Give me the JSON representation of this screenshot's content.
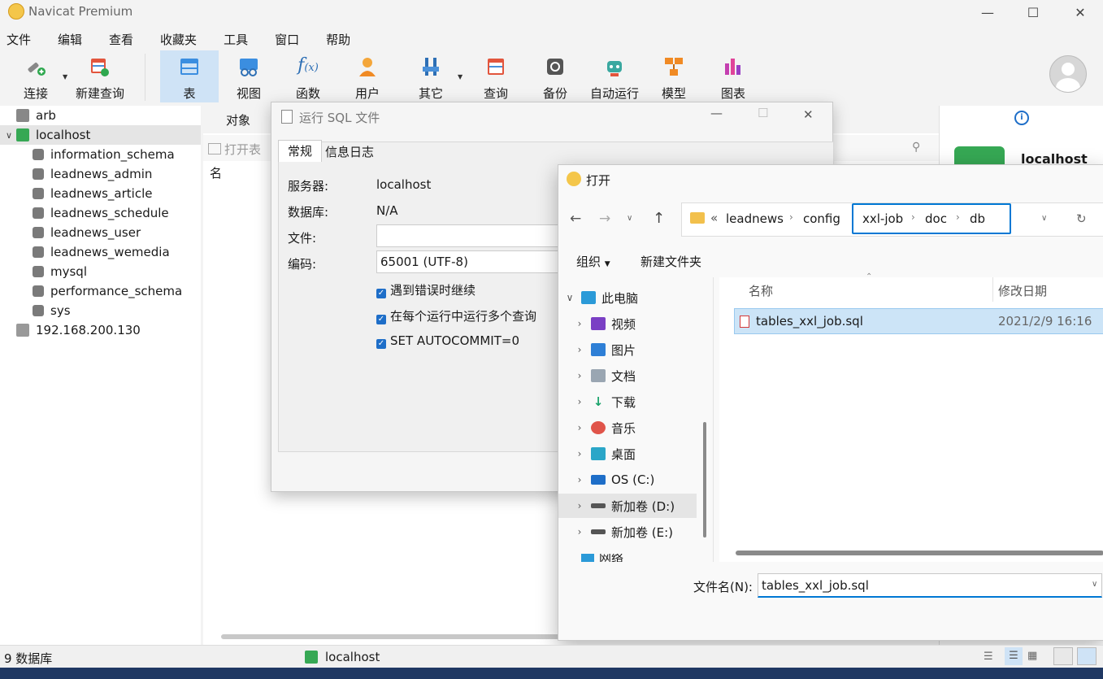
{
  "app": {
    "title": "Navicat Premium"
  },
  "menu": [
    "文件",
    "编辑",
    "查看",
    "收藏夹",
    "工具",
    "窗口",
    "帮助"
  ],
  "toolbar": {
    "connect": "连接",
    "new_query": "新建查询",
    "table": "表",
    "view": "视图",
    "function": "函数",
    "user": "用户",
    "other": "其它",
    "query": "查询",
    "backup": "备份",
    "auto_run": "自动运行",
    "model": "模型",
    "chart": "图表"
  },
  "tree": {
    "arb": "arb",
    "localhost": "localhost",
    "databases": [
      "information_schema",
      "leadnews_admin",
      "leadnews_article",
      "leadnews_schedule",
      "leadnews_user",
      "leadnews_wemedia",
      "mysql",
      "performance_schema",
      "sys"
    ],
    "remote": "192.168.200.130"
  },
  "main": {
    "tab_objects": "对象",
    "open_table": "打开表",
    "col_name": "名"
  },
  "right_panel": {
    "conn_name": "localhost"
  },
  "status": {
    "db_count": "9 数据库",
    "connection": "localhost"
  },
  "sql_dialog": {
    "title": "运行 SQL 文件",
    "tab_general": "常规",
    "tab_log": "信息日志",
    "server_label": "服务器:",
    "server_value": "localhost",
    "database_label": "数据库:",
    "database_value": "N/A",
    "file_label": "文件:",
    "file_value": "",
    "encoding_label": "编码:",
    "encoding_value": "65001 (UTF-8)",
    "opt_continue": "遇到错误时继续",
    "opt_multi": "在每个运行中运行多个查询",
    "opt_autocommit": "SET AUTOCOMMIT=0"
  },
  "open_dialog": {
    "title": "打开",
    "path_prefix": "«",
    "path_1": "leadnews",
    "path_2": "config",
    "path_3": "xxl-job",
    "path_4": "doc",
    "path_5": "db",
    "organize": "组织",
    "new_folder": "新建文件夹",
    "nav": {
      "this_pc": "此电脑",
      "videos": "视频",
      "pictures": "图片",
      "documents": "文档",
      "downloads": "下载",
      "music": "音乐",
      "desktop": "桌面",
      "drive_c": "OS (C:)",
      "drive_d": "新加卷 (D:)",
      "drive_e": "新加卷 (E:)",
      "network_partial": "网络"
    },
    "col_name": "名称",
    "col_date": "修改日期",
    "file_name": "tables_xxl_job.sql",
    "file_date": "2021/2/9 16:16",
    "filename_label": "文件名(N):",
    "filename_value": "tables_xxl_job.sql"
  },
  "colors": {
    "accent": "#0078d4",
    "selection": "#cce4f7",
    "toolbar_active": "#cfe3f6"
  }
}
